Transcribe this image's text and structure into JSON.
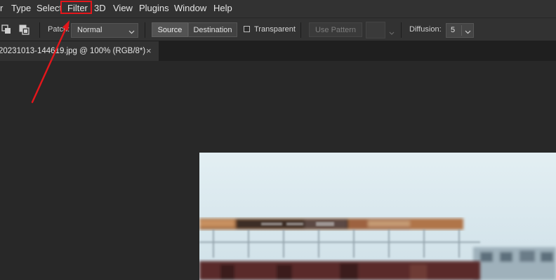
{
  "menu": {
    "items": [
      {
        "key": "partial",
        "label": "r"
      },
      {
        "key": "type",
        "label": "Type"
      },
      {
        "key": "select",
        "label": "Select"
      },
      {
        "key": "filter",
        "label": "Filter"
      },
      {
        "key": "3d",
        "label": "3D"
      },
      {
        "key": "view",
        "label": "View"
      },
      {
        "key": "plugins",
        "label": "Plugins"
      },
      {
        "key": "window",
        "label": "Window"
      },
      {
        "key": "help",
        "label": "Help"
      }
    ]
  },
  "options": {
    "patch_label": "Patch:",
    "patch_mode": "Normal",
    "source_label": "Source",
    "destination_label": "Destination",
    "transparent_label": "Transparent",
    "use_pattern_label": "Use Pattern",
    "diffusion_label": "Diffusion:",
    "diffusion_value": "5"
  },
  "tab": {
    "title": "20231013-144619.jpg @ 100% (RGB/8*)",
    "close_glyph": "×"
  },
  "icons": [
    "selection-mode-new-icon",
    "selection-mode-add-icon",
    "checkbox-icon",
    "chevron-down-icon",
    "close-icon",
    "red-arrow-annotation",
    "red-highlight-box"
  ],
  "colors": {
    "ui_dark": "#323232",
    "workspace": "#282828",
    "annotation_red": "#e4161b",
    "sky": "#d9e8ee"
  }
}
